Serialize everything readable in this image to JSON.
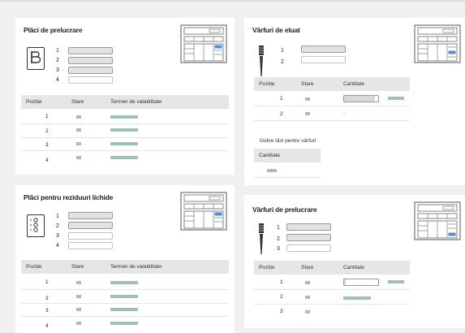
{
  "panels": {
    "processing_plates": {
      "title": "Plăci de prelucrare",
      "slots": [
        "1",
        "2",
        "3",
        "4"
      ],
      "columns": [
        "Poziție",
        "Stare",
        "Termen de valabilitate"
      ],
      "rows": [
        {
          "position": "1",
          "status": "ok",
          "expiry_fill": 1.0
        },
        {
          "position": "2",
          "status": "ok",
          "expiry_fill": 1.0
        },
        {
          "position": "3",
          "status": "ok",
          "expiry_fill": 1.0
        },
        {
          "position": "4",
          "status": "ok",
          "expiry_fill": 1.0
        }
      ]
    },
    "eluate_tips": {
      "title": "Vârfuri de eluat",
      "slots": [
        "1",
        "2"
      ],
      "columns": [
        "Poziție",
        "Stare",
        "Cantitate"
      ],
      "rows": [
        {
          "position": "1",
          "status": "ok",
          "quantity_fill": 0.9
        },
        {
          "position": "2",
          "status": "ok",
          "quantity_text": "-"
        }
      ],
      "empty_trays_label": "Golire tăvi pentru vârfuri",
      "empty_trays_column": "Cantitate"
    },
    "liquid_waste_plates": {
      "title": "Plăci pentru reziduuri lichide",
      "slots": [
        "1",
        "2",
        "3",
        "4"
      ],
      "columns": [
        "Poziție",
        "Stare",
        "Termen de valabilitate"
      ],
      "rows": [
        {
          "position": "1",
          "status": "ok",
          "expiry_fill": 1.0
        },
        {
          "position": "2",
          "status": "ok",
          "expiry_fill": 1.0
        },
        {
          "position": "3",
          "status": "ok",
          "expiry_fill": 1.0
        },
        {
          "position": "4",
          "status": "ok",
          "expiry_fill": 1.0
        }
      ]
    },
    "processing_tips": {
      "title": "Vârfuri de prelucrare",
      "slots": [
        "1",
        "2",
        "3"
      ],
      "columns": [
        "Poziție",
        "Stare",
        "Cantitate"
      ],
      "rows": [
        {
          "position": "1",
          "status": "ok",
          "quantity_fill": 0.05
        },
        {
          "position": "2",
          "status": "ok"
        },
        {
          "position": "3",
          "status": "ok"
        }
      ]
    }
  },
  "colors": {
    "status_ok": "#a8bfb6",
    "bar": "#9fc0b4",
    "highlight_slot": "#4a90d9"
  }
}
